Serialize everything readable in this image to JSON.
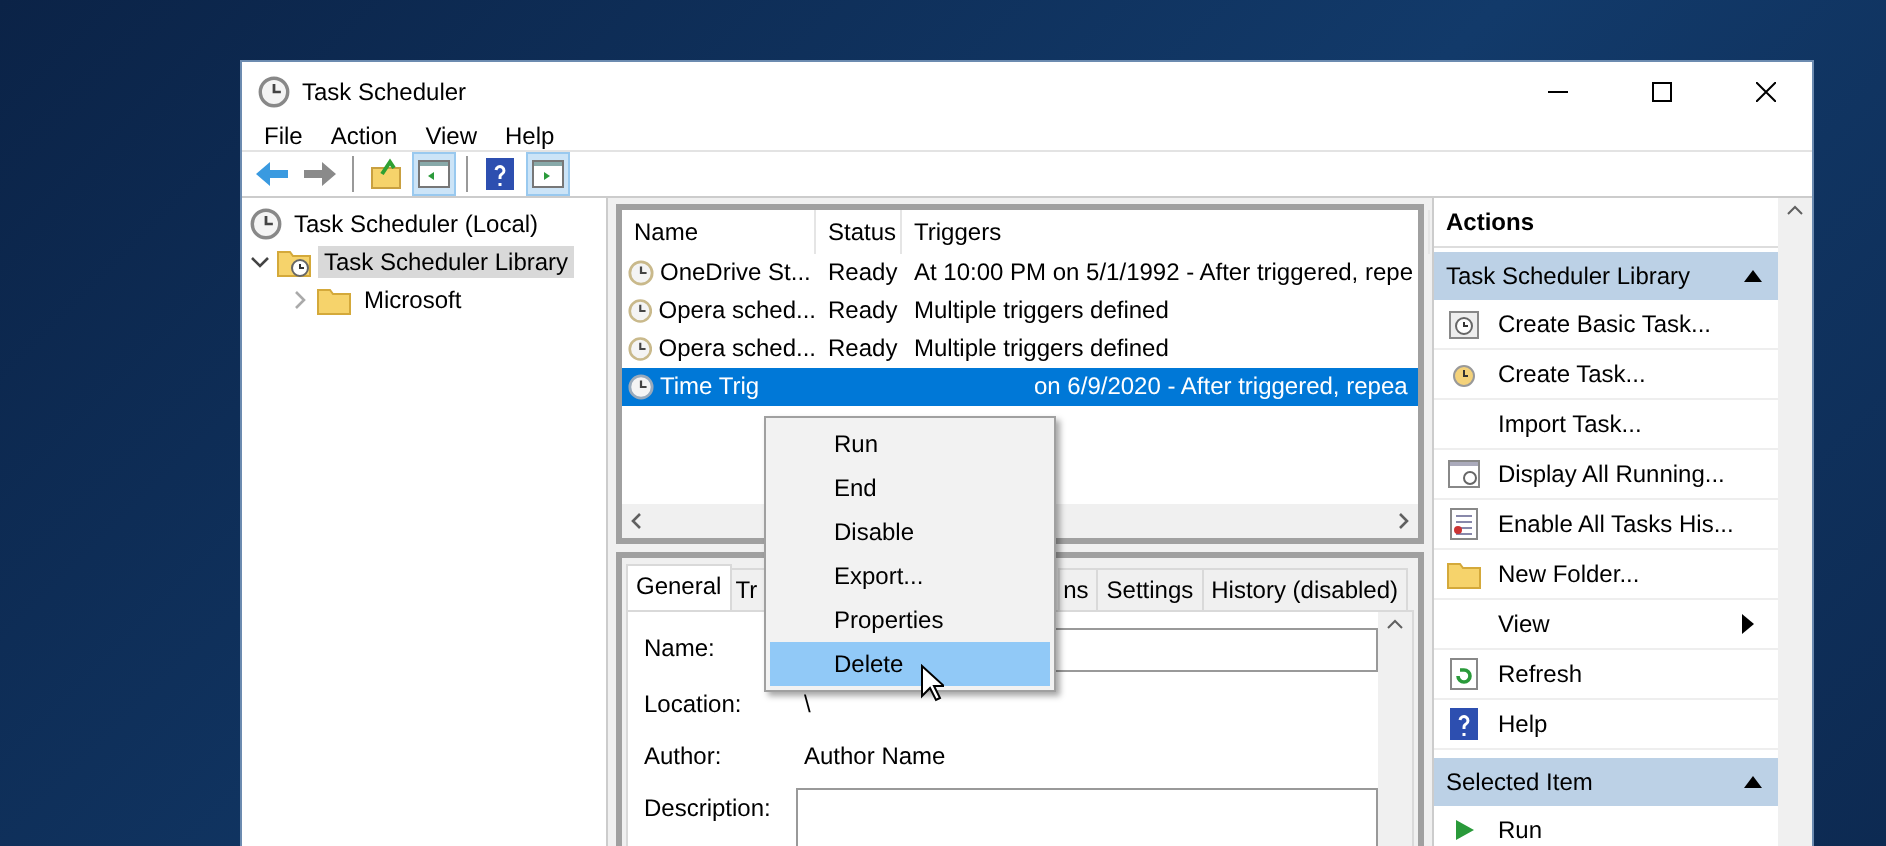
{
  "window": {
    "title": "Task Scheduler"
  },
  "menu": [
    "File",
    "Action",
    "View",
    "Help"
  ],
  "toolbar": [
    {
      "kind": "back",
      "on": false
    },
    {
      "kind": "forward",
      "on": false
    },
    {
      "kind": "folder_up",
      "on": false
    },
    {
      "kind": "tree_pane",
      "on": true
    },
    {
      "kind": "help",
      "on": false
    },
    {
      "kind": "action_pane",
      "on": true
    }
  ],
  "tree": {
    "root": "Task Scheduler (Local)",
    "children": [
      {
        "label": "Task Scheduler Library",
        "selected": true,
        "expanded": true,
        "children": [
          {
            "label": "Microsoft",
            "selected": false,
            "expanded": false
          }
        ]
      }
    ]
  },
  "task_list": {
    "columns": [
      "Name",
      "Status",
      "Triggers"
    ],
    "rows": [
      {
        "name": "OneDrive St...",
        "status": "Ready",
        "triggers": "At 10:00 PM on 5/1/1992 - After triggered, repe",
        "selected": false
      },
      {
        "name": "Opera sched...",
        "status": "Ready",
        "triggers": "Multiple triggers defined",
        "selected": false
      },
      {
        "name": "Opera sched...",
        "status": "Ready",
        "triggers": "Multiple triggers defined",
        "selected": false
      },
      {
        "name": "Time Trig",
        "triggers": "on 6/9/2020 - After triggered, repea",
        "selected": true
      }
    ]
  },
  "context_menu": [
    {
      "label": "Run",
      "selected": false
    },
    {
      "label": "End",
      "selected": false
    },
    {
      "label": "Disable",
      "selected": false
    },
    {
      "label": "Export...",
      "selected": false
    },
    {
      "label": "Properties",
      "selected": false
    },
    {
      "label": "Delete",
      "selected": true
    }
  ],
  "details": {
    "tabs": [
      {
        "label": "General",
        "selected": true
      },
      {
        "label": "Tr",
        "selected": false
      },
      {
        "label": "ns",
        "selected": false
      },
      {
        "label": "Settings",
        "selected": false
      },
      {
        "label": "History (disabled)",
        "selected": false
      }
    ],
    "fields": [
      {
        "kind": "input",
        "label": "Name:"
      },
      {
        "kind": "text",
        "label": "Location:",
        "value": "\\"
      },
      {
        "kind": "text",
        "label": "Author:",
        "value": "Author Name"
      },
      {
        "kind": "textarea",
        "label": "Description:"
      }
    ]
  },
  "actions": {
    "title": "Actions",
    "sections": [
      {
        "title": "Task Scheduler Library",
        "expanded": true,
        "items": [
          {
            "label": "Create Basic Task...",
            "submenu": false
          },
          {
            "label": "Create Task...",
            "submenu": false
          },
          {
            "label": "Import Task...",
            "submenu": false
          },
          {
            "label": "Display All Running...",
            "submenu": false
          },
          {
            "label": "Enable All Tasks His...",
            "submenu": false
          },
          {
            "label": "New Folder...",
            "submenu": false
          },
          {
            "label": "View",
            "submenu": true
          },
          {
            "label": "Refresh",
            "submenu": false
          },
          {
            "label": "Help",
            "submenu": false
          }
        ]
      },
      {
        "title": "Selected Item",
        "expanded": true,
        "items": [
          {
            "label": "Run",
            "submenu": false
          }
        ]
      }
    ]
  }
}
